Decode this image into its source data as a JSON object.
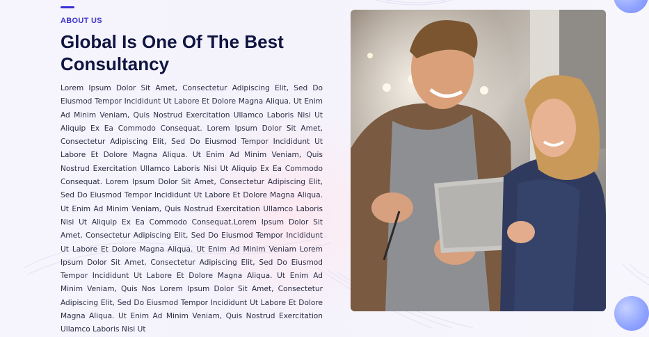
{
  "about": {
    "eyebrow": "ABOUT US",
    "title": "Global Is One Of The Best Consultancy",
    "body": "Lorem Ipsum Dolor Sit Amet, Consectetur Adipiscing Elit, Sed Do Eiusmod Tempor Incididunt Ut Labore Et Dolore Magna Aliqua. Ut Enim Ad Minim Veniam, Quis Nostrud Exercitation Ullamco Laboris Nisi Ut Aliquip Ex Ea Commodo Consequat. Lorem Ipsum Dolor Sit Amet, Consectetur Adipiscing Elit, Sed Do Eiusmod Tempor Incididunt Ut Labore Et Dolore Magna Aliqua. Ut Enim Ad Minim Veniam, Quis Nostrud Exercitation Ullamco Laboris Nisi Ut Aliquip Ex Ea Commodo Consequat. Lorem Ipsum Dolor Sit Amet, Consectetur Adipiscing Elit, Sed Do Eiusmod Tempor Incididunt Ut Labore Et Dolore Magna Aliqua. Ut Enim Ad Minim Veniam, Quis Nostrud Exercitation Ullamco Laboris Nisi Ut Aliquip Ex Ea Commodo Consequat.Lorem Ipsum Dolor Sit Amet, Consectetur Adipiscing Elit, Sed Do Eiusmod Tempor Incididunt Ut Labore Et Dolore Magna Aliqua. Ut Enim Ad Minim Veniam Lorem Ipsum Dolor Sit Amet, Consectetur Adipiscing Elit, Sed Do Eiusmod Tempor Incididunt Ut Labore Et Dolore Magna Aliqua. Ut Enim Ad Minim Veniam, Quis Nos Lorem Ipsum Dolor Sit Amet, Consectetur Adipiscing Elit, Sed Do Eiusmod Tempor Incididunt Ut Labore Et Dolore Magna Aliqua. Ut Enim Ad Minim Veniam, Quis Nostrud Exercitation Ullamco Laboris Nisi Ut"
  },
  "colors": {
    "accent": "#3b2fd6",
    "heading": "#0f1440",
    "body": "#2a2d45",
    "orb": "#8ea2ff"
  },
  "image": {
    "icon": "team-photo"
  }
}
